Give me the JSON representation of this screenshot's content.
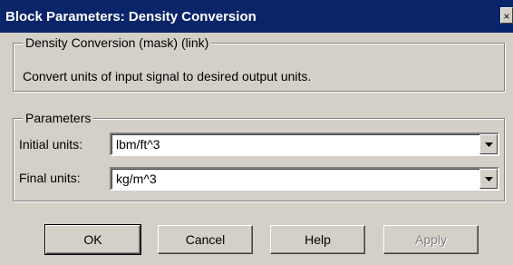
{
  "window": {
    "title": "Block Parameters: Density Conversion",
    "close_glyph": "×"
  },
  "mask_group": {
    "legend": "Density Conversion (mask) (link)",
    "description": "Convert units of input signal to desired output units."
  },
  "params_group": {
    "legend": "Parameters",
    "initial_units": {
      "label": "Initial units:",
      "value": "lbm/ft^3"
    },
    "final_units": {
      "label": "Final units:",
      "value": "kg/m^3"
    }
  },
  "buttons": {
    "ok": "OK",
    "cancel": "Cancel",
    "help": "Help",
    "apply": "Apply"
  },
  "colors": {
    "titlebar": "#0a246a",
    "face": "#d4d0c8"
  }
}
